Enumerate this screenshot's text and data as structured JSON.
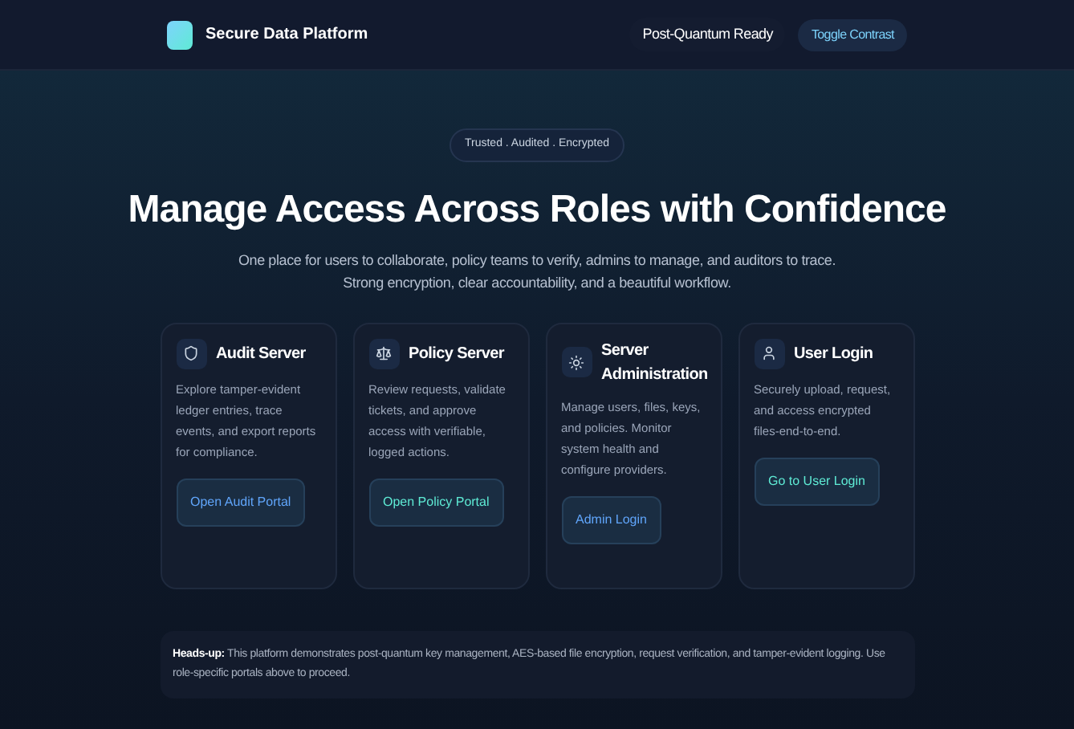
{
  "header": {
    "brand": "Secure Data Platform",
    "status": "Post-Quantum Ready",
    "toggle": "Toggle Contrast"
  },
  "hero": {
    "badge": "Trusted . Audited . Encrypted",
    "title": "Manage Access Across Roles with Confidence",
    "subtitle": [
      "One place for users to collaborate, policy teams to verify, admins to manage, and auditors to trace.",
      "Strong encryption, clear accountability, and a beautiful workflow."
    ]
  },
  "cards": [
    {
      "title": "Audit Server",
      "text": "Explore tamper-evident ledger entries, trace events, and export reports for compliance.",
      "button": "Open Audit Portal",
      "color": "#60a5fa"
    },
    {
      "title": "Policy Server",
      "text": "Review requests, validate tickets, and approve access with verifiable, logged actions.",
      "button": "Open Policy Portal",
      "color": "#5eead4"
    },
    {
      "title": "Server Administration",
      "text": "Manage users, files, keys, and policies. Monitor system health and configure providers.",
      "button": "Admin Login",
      "color": "#60a5fa"
    },
    {
      "title": "User Login",
      "text": "Securely upload, request, and access encrypted files-end-to-end.",
      "button": "Go to User Login",
      "color": "#5eead4"
    }
  ],
  "notice": "**Heads-up:** This platform demonstrates post-quantum key management, AES-based file encryption, request verification, and tamper-evident logging. Use role-specific portals above to proceed."
}
